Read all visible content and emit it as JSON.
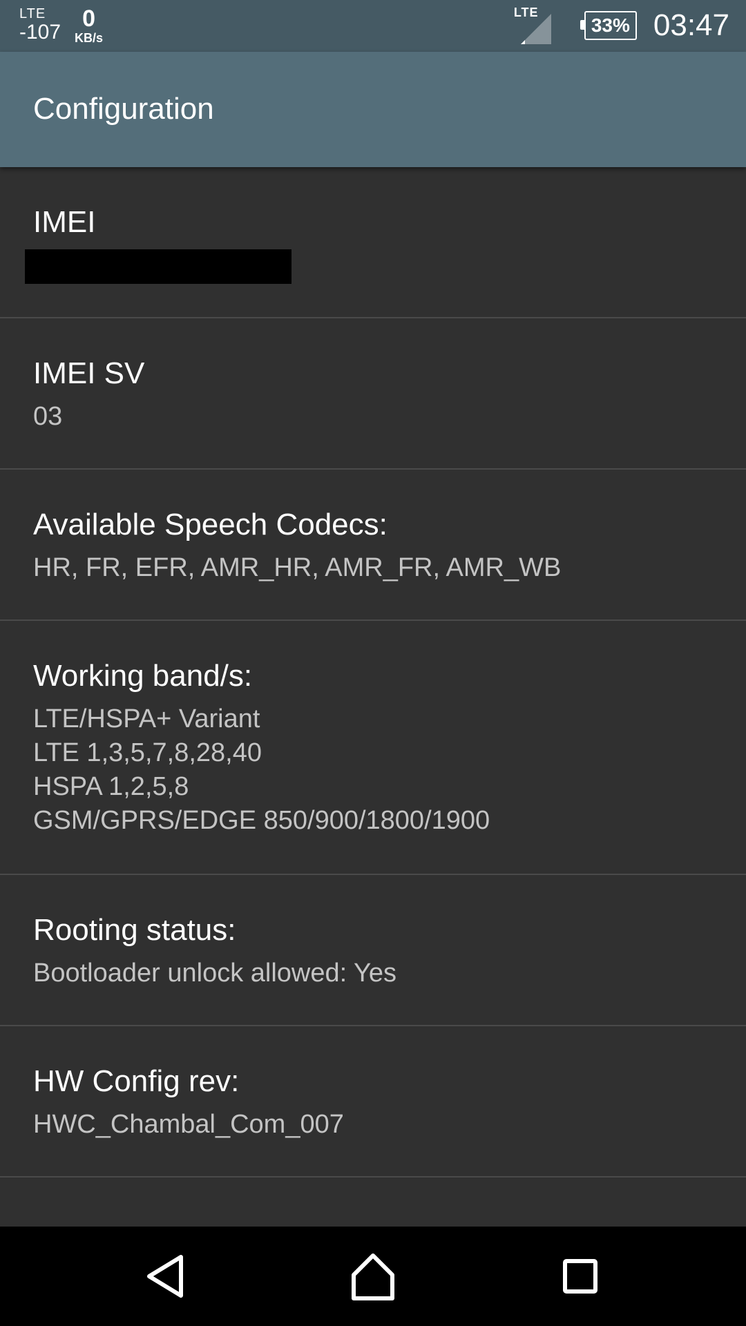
{
  "status_bar": {
    "network_type": "LTE",
    "signal_dbm": "-107",
    "data_rate": "0",
    "data_rate_unit": "KB/s",
    "signal_label": "LTE",
    "battery": "33%",
    "time": "03:47"
  },
  "app_bar": {
    "title": "Configuration"
  },
  "items": [
    {
      "title": "IMEI",
      "value": ""
    },
    {
      "title": "IMEI SV",
      "value": "03"
    },
    {
      "title": "Available Speech Codecs:",
      "value": "HR, FR, EFR, AMR_HR, AMR_FR, AMR_WB"
    },
    {
      "title": "Working band/s:",
      "lines": [
        "LTE/HSPA+ Variant",
        "LTE 1,3,5,7,8,28,40",
        "HSPA 1,2,5,8",
        "GSM/GPRS/EDGE 850/900/1800/1900"
      ]
    },
    {
      "title": "Rooting status:",
      "value": "Bootloader unlock allowed: Yes"
    },
    {
      "title": "HW Config rev:",
      "value": "HWC_Chambal_Com_007"
    }
  ],
  "icons": {
    "signal": "signal-icon",
    "battery": "battery-icon",
    "back": "back-icon",
    "home": "home-icon",
    "recents": "recents-icon"
  },
  "colors": {
    "status_bar": "#455A64",
    "app_bar": "#546E7A",
    "background": "#303030",
    "divider": "#4a4a4a",
    "title_text": "#ffffff",
    "value_text": "#c4c4c4"
  }
}
